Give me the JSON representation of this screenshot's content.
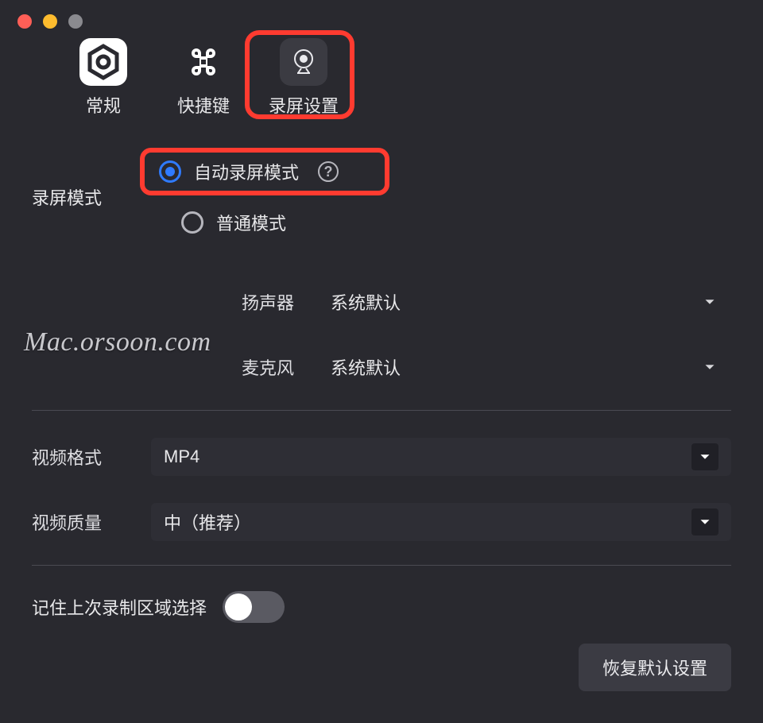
{
  "tabs": {
    "general": "常规",
    "shortcut": "快捷键",
    "recording": "录屏设置"
  },
  "mode": {
    "label": "录屏模式",
    "auto": "自动录屏模式",
    "normal": "普通模式"
  },
  "audio": {
    "speaker_label": "扬声器",
    "speaker_value": "系统默认",
    "mic_label": "麦克风",
    "mic_value": "系统默认"
  },
  "video": {
    "format_label": "视频格式",
    "format_value": "MP4",
    "quality_label": "视频质量",
    "quality_value": "中（推荐）"
  },
  "remember_label": "记住上次录制区域选择",
  "restore_button": "恢复默认设置",
  "watermark": "Mac.orsoon.com"
}
